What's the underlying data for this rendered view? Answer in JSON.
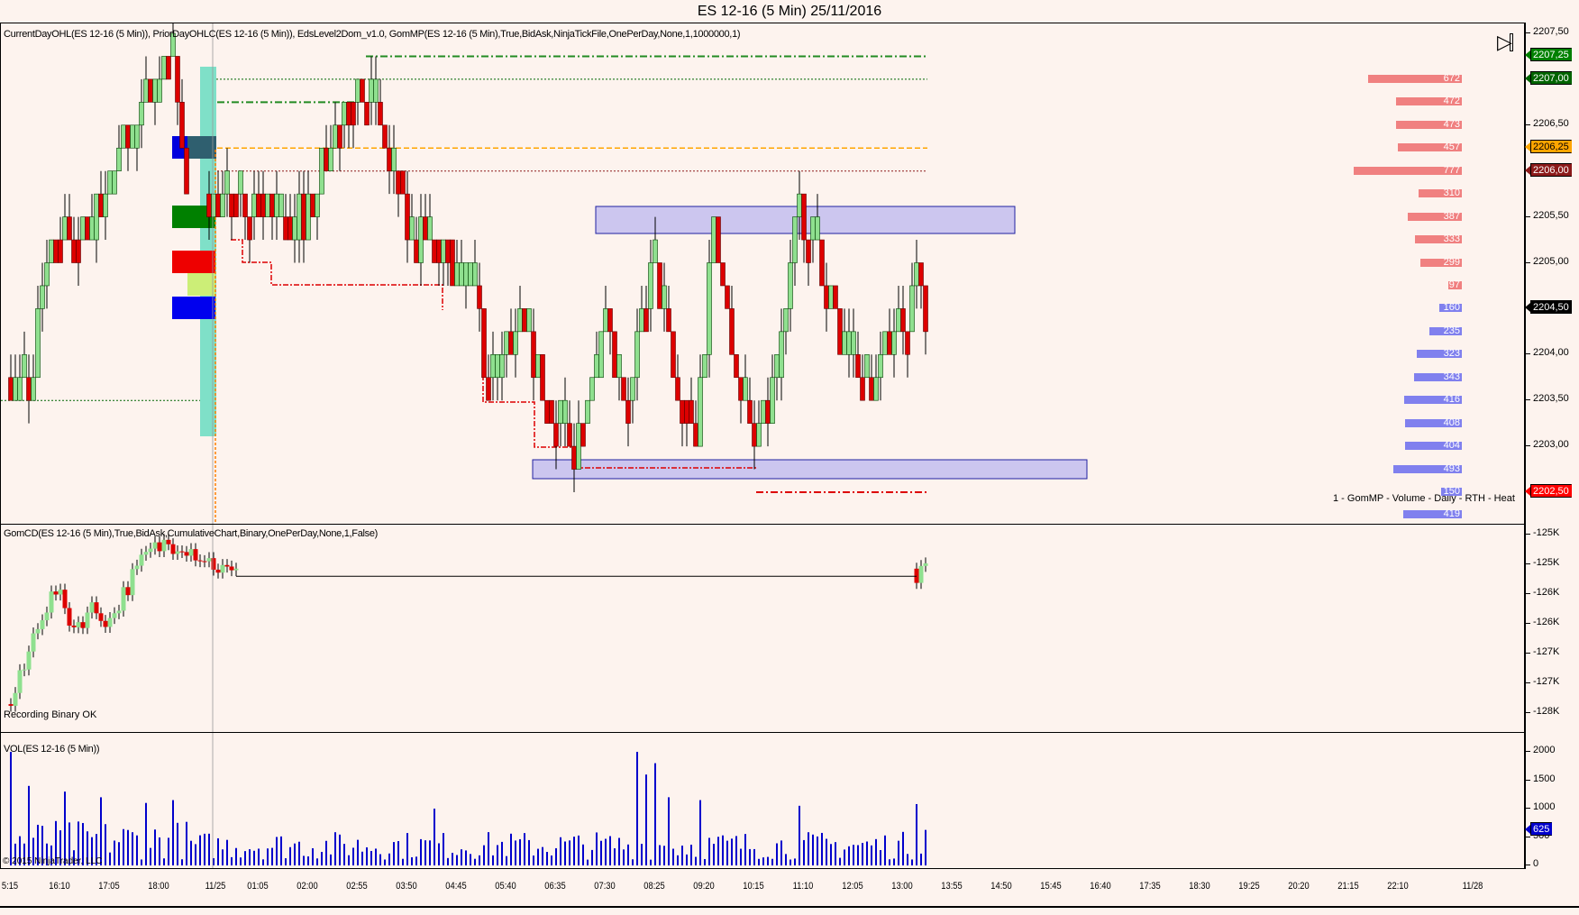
{
  "title": "ES 12-16 (5 Min)  25/11/2016",
  "main": {
    "indicator_label": "CurrentDayOHL(ES 12-16 (5 Min)), PriorDayOHLC(ES 12-16 (5 Min)), EdsLevel2Dom_v1.0, GomMP(ES 12-16 (5 Min),True,BidAsk,NinjaTickFile,OnePerDay,None,1,1000000,1)",
    "profile_label": "1 - GomMP - Volume - Daily - RTH - Heat",
    "scroll_end_icon": "play-to-end-icon",
    "price_axis": [
      "2207,50",
      "2206,50",
      "2205,50",
      "2205,00",
      "2204,00",
      "2203,50",
      "2203,00"
    ],
    "price_axis_values": [
      2207.5,
      2206.5,
      2205.5,
      2205.0,
      2204.0,
      2203.5,
      2203.0
    ],
    "price_tags": [
      {
        "price": 2207.25,
        "label": "2207,25",
        "color": "#008000"
      },
      {
        "price": 2207.0,
        "label": "2207,00",
        "color": "#006400"
      },
      {
        "price": 2206.25,
        "label": "2206,25",
        "color": "#ffa500"
      },
      {
        "price": 2206.0,
        "label": "2206,00",
        "color": "#8b1a1a"
      },
      {
        "price": 2204.5,
        "label": "2204,50",
        "color": "#000000"
      },
      {
        "price": 2202.5,
        "label": "2202,50",
        "color": "#ff0000"
      }
    ],
    "dom_asks": [
      [
        2207.0,
        672
      ],
      [
        2206.75,
        472
      ],
      [
        2206.5,
        473
      ],
      [
        2206.25,
        457
      ],
      [
        2206.0,
        777
      ],
      [
        2205.75,
        310
      ],
      [
        2205.5,
        387
      ],
      [
        2205.25,
        333
      ],
      [
        2205.0,
        299
      ],
      [
        2204.75,
        97
      ]
    ],
    "dom_bids": [
      [
        2204.5,
        160
      ],
      [
        2204.25,
        235
      ],
      [
        2204.0,
        323
      ],
      [
        2203.75,
        343
      ],
      [
        2203.5,
        416
      ],
      [
        2203.25,
        408
      ],
      [
        2203.0,
        404
      ],
      [
        2202.75,
        493
      ],
      [
        2202.5,
        150
      ],
      [
        2202.25,
        419
      ]
    ],
    "price_path": [
      [
        0,
        2203.75
      ],
      [
        4,
        2203.5
      ],
      [
        7,
        2204.75
      ],
      [
        11,
        2205.25
      ],
      [
        20,
        2205.5
      ],
      [
        25,
        2206.25
      ],
      [
        32,
        2207.0
      ],
      [
        36,
        2207.0
      ],
      [
        39,
        2206.0
      ],
      [
        45,
        2205.75
      ],
      [
        49,
        2205.5
      ],
      [
        65,
        2205.5
      ],
      [
        71,
        2206.25
      ],
      [
        77,
        2207.0
      ],
      [
        80,
        2207.0
      ],
      [
        84,
        2206.0
      ],
      [
        89,
        2205.25
      ],
      [
        96,
        2205.0
      ],
      [
        103,
        2204.75
      ],
      [
        105,
        2203.75
      ],
      [
        114,
        2204.25
      ],
      [
        123,
        2203.0
      ],
      [
        125,
        2203.0
      ],
      [
        132,
        2204.25
      ],
      [
        136,
        2203.25
      ],
      [
        143,
        2205.0
      ],
      [
        147,
        2203.75
      ],
      [
        152,
        2203.0
      ],
      [
        156,
        2205.5
      ],
      [
        161,
        2203.75
      ],
      [
        165,
        2203.0
      ],
      [
        170,
        2203.75
      ],
      [
        174,
        2205.5
      ],
      [
        179,
        2205.0
      ],
      [
        185,
        2204.0
      ],
      [
        192,
        2203.75
      ],
      [
        196,
        2204.25
      ],
      [
        201,
        2204.75
      ],
      [
        203,
        2204.5
      ]
    ]
  },
  "cd": {
    "indicator_label": "GomCD(ES 12-16 (5 Min),True,BidAsk,CumulativeChart,Binary,OnePerDay,None,1,False)",
    "status": "Recording Binary OK",
    "axis": [
      "-125K",
      "-125K",
      "-126K",
      "-126K",
      "-127K",
      "-127K",
      "-128K"
    ],
    "path": [
      [
        0,
        -127.6
      ],
      [
        3,
        -127.0
      ],
      [
        6,
        -126.2
      ],
      [
        10,
        -125.7
      ],
      [
        14,
        -126.3
      ],
      [
        18,
        -126.0
      ],
      [
        22,
        -126.2
      ],
      [
        26,
        -125.6
      ],
      [
        30,
        -125.1
      ],
      [
        34,
        -124.9
      ],
      [
        38,
        -124.9
      ],
      [
        42,
        -125.1
      ],
      [
        46,
        -125.3
      ],
      [
        50,
        -125.45
      ],
      [
        201,
        -125.45
      ],
      [
        202,
        -125.2
      ],
      [
        203,
        -125.25
      ]
    ]
  },
  "vol": {
    "indicator_label": "VOL(ES 12-16 (5 Min))",
    "copyright": "© 2015 NinjaTrader, LLC",
    "axis": [
      "2000",
      "1500",
      "1000",
      "500",
      "0"
    ],
    "axis_values": [
      2000,
      1500,
      1000,
      500,
      0
    ],
    "last_tag": "625",
    "spikes": [
      [
        0,
        2000
      ],
      [
        4,
        1400
      ],
      [
        12,
        1300
      ],
      [
        20,
        1200
      ],
      [
        30,
        1100
      ],
      [
        36,
        1150
      ],
      [
        94,
        1000
      ],
      [
        139,
        2000
      ],
      [
        141,
        1600
      ],
      [
        143,
        1800
      ],
      [
        146,
        1200
      ],
      [
        153,
        1150
      ],
      [
        175,
        1050
      ],
      [
        201,
        1080
      ],
      [
        203,
        625
      ]
    ]
  },
  "time_axis": [
    "5:15",
    "16:10",
    "17:05",
    "18:00",
    "11/25",
    "01:05",
    "02:00",
    "02:55",
    "03:50",
    "04:45",
    "05:40",
    "06:35",
    "07:30",
    "08:25",
    "09:20",
    "10:15",
    "11:10",
    "12:05",
    "13:00",
    "13:55",
    "14:50",
    "15:45",
    "16:40",
    "17:35",
    "18:30",
    "19:25",
    "20:20",
    "21:15",
    "22:10",
    "11/28"
  ]
}
